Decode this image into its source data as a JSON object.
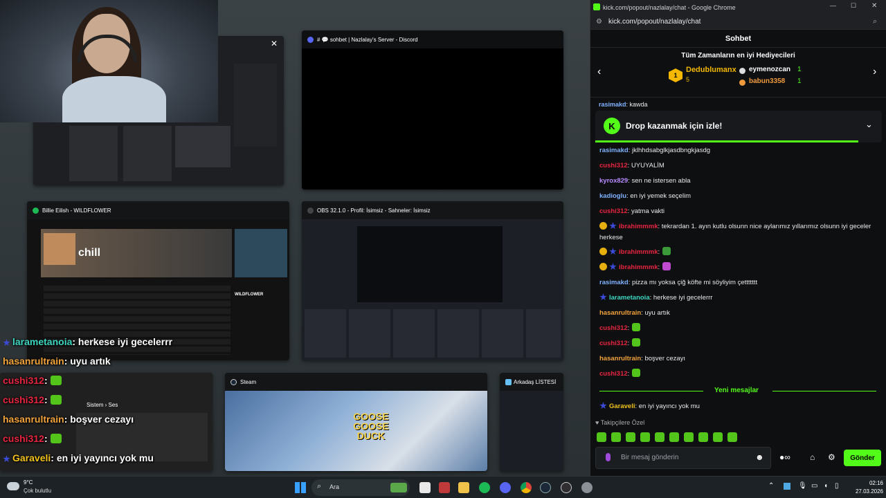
{
  "desktop": {
    "windows": [
      {
        "title": "",
        "kind": "discord-overview"
      },
      {
        "title": "# 💬 sohbet | Nazlalay's Server - Discord",
        "kind": "discord-chat"
      },
      {
        "title": "Billie Eilish - WILDFLOWER",
        "kind": "spotify",
        "playlist": "chill",
        "now_playing": "WILDFLOWER"
      },
      {
        "title": "OBS 32.1.0 - Profil: İsimsiz - Sahneler: İsimsiz",
        "kind": "obs"
      },
      {
        "title": "",
        "kind": "settings",
        "section": "Sistem › Ses"
      },
      {
        "title": "Steam",
        "kind": "steam",
        "game": "GOOSE GOOSE DUCK"
      },
      {
        "title": "Arkadaş LİSTESİ",
        "kind": "friends"
      }
    ],
    "overlay_chat": [
      {
        "user": "larametanoia",
        "text": ": herkese iyi gecelerrr",
        "color": "#3cd7c0",
        "badge": true
      },
      {
        "user": "hasanrultrain",
        "text": ": uyu artık",
        "color": "#f2a33a",
        "badge": false
      },
      {
        "user": "cushi312",
        "text": ":",
        "color": "#e8253f",
        "badge": false,
        "emote": true
      },
      {
        "user": "cushi312",
        "text": ":",
        "color": "#e8253f",
        "badge": false,
        "emote": true
      },
      {
        "user": "hasanrultrain",
        "text": ": boşver cezayı",
        "color": "#f2a33a",
        "badge": false
      },
      {
        "user": "cushi312",
        "text": ":",
        "color": "#e8253f",
        "badge": false,
        "emote": true
      },
      {
        "user": "Garaveli",
        "text": ": en iyi yayıncı yok mu",
        "color": "#f2c21b",
        "badge": true
      }
    ]
  },
  "taskbar": {
    "weather_temp": "9°C",
    "weather_desc": "Çok bulutlu",
    "search_placeholder": "Ara",
    "time": "02:16",
    "date": "27.03.2026"
  },
  "chrome": {
    "title": "kick.com/popout/nazlalay/chat - Google Chrome",
    "url": "kick.com/popout/nazlalay/chat"
  },
  "chat": {
    "header": "Sohbet",
    "gifters_title": "Tüm Zamanların en iyi Hediyecileri",
    "gifters": [
      {
        "name": "Dedublumanx",
        "count": "5",
        "rank": "1",
        "color": "#f5b800"
      },
      {
        "name": "eymenozcan",
        "count": "1",
        "rank": "2",
        "color": "#ffffff"
      },
      {
        "name": "babun3358",
        "count": "1",
        "rank": "3",
        "color": "#f09a3c"
      }
    ],
    "partial_message": {
      "user": "rasimakd",
      "text": ": kawda"
    },
    "drop_text": "Drop kazanmak için izle!",
    "messages": [
      {
        "user": "rasimakd",
        "text": ": jklhhdsabglkjasdbngkjasdg",
        "color": "#7fb2ff",
        "badges": []
      },
      {
        "user": "cushi312",
        "text": ": UYUYALİM",
        "color": "#e8253f",
        "badges": []
      },
      {
        "user": "kyrox829",
        "text": ": sen ne istersen abla",
        "color": "#b98cff",
        "badges": []
      },
      {
        "user": "kadioglu",
        "text": ": en iyi yemek seçelim",
        "color": "#7fb2ff",
        "badges": []
      },
      {
        "user": "cushi312",
        "text": ": yatma vakti",
        "color": "#e8253f",
        "badges": []
      },
      {
        "user": "ibrahimmmk",
        "text": ": tekrardan 1. ayın kutlu olsunn nice aylarımız yıllarımız olsunn iyi geceler herkese",
        "color": "#e8253f",
        "badges": [
          "coin",
          "star"
        ]
      },
      {
        "user": "ibrahimmmk",
        "text": ":",
        "color": "#e8253f",
        "badges": [
          "coin",
          "star"
        ],
        "emote": "#3a9a3a"
      },
      {
        "user": "ibrahimmmk",
        "text": ":",
        "color": "#e8253f",
        "badges": [
          "coin",
          "star"
        ],
        "emote": "#c04ad0"
      },
      {
        "user": "rasimakd",
        "text": ": pizza mı yoksa çiğ köfte mi söyliyim çettttttt",
        "color": "#7fb2ff",
        "badges": []
      },
      {
        "user": "larametanoia",
        "text": ": herkese iyi gecelerrr",
        "color": "#3cd7c0",
        "badges": [
          "star"
        ]
      },
      {
        "user": "hasanrultrain",
        "text": ": uyu artık",
        "color": "#f2a33a",
        "badges": []
      },
      {
        "user": "cushi312",
        "text": ":",
        "color": "#e8253f",
        "badges": [],
        "emote": "#53c41a"
      },
      {
        "user": "cushi312",
        "text": ":",
        "color": "#e8253f",
        "badges": [],
        "emote": "#53c41a"
      },
      {
        "user": "hasanrultrain",
        "text": ": boşver cezayı",
        "color": "#f2a33a",
        "badges": []
      },
      {
        "user": "cushi312",
        "text": ":",
        "color": "#e8253f",
        "badges": [],
        "emote": "#53c41a"
      }
    ],
    "new_messages_label": "Yeni mesajlar",
    "after_messages": [
      {
        "user": "Garaveli",
        "text": ": en iyi yayıncı yok mu",
        "color": "#f2c21b",
        "badges": [
          "star"
        ]
      }
    ],
    "followers_only": "Takipçilere Özel",
    "input_placeholder": "Bir mesaj gönderin",
    "send_label": "Gönder"
  }
}
